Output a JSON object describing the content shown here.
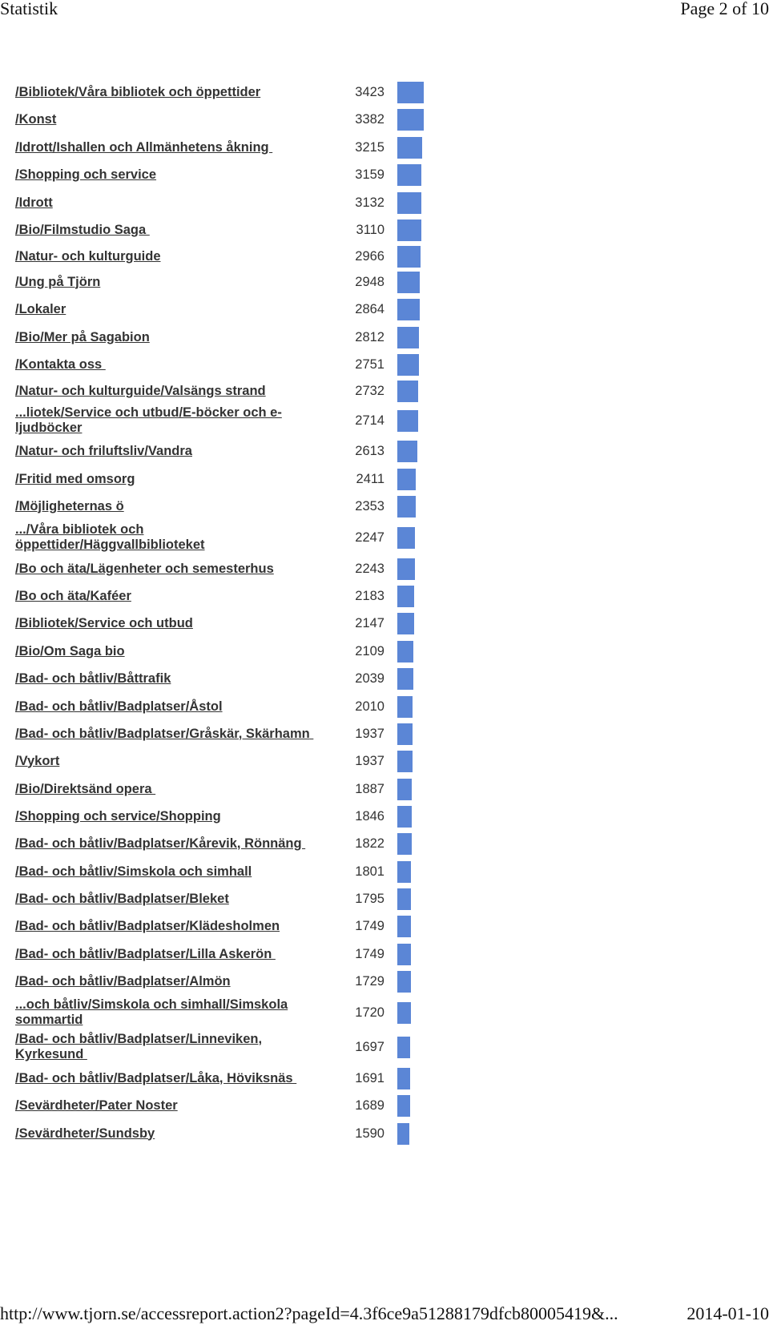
{
  "header": {
    "title": "Statistik",
    "page": "Page 2 of 10"
  },
  "footer": {
    "url": "http://www.tjorn.se/accessreport.action2?pageId=4.3f6ce9a51288179dfcb80005419&...",
    "date": "2014-01-10"
  },
  "colors": {
    "bar": "#5B86D6",
    "text": "#333333"
  },
  "chart_data": {
    "type": "bar",
    "orientation": "horizontal",
    "title": "",
    "xlabel": "",
    "ylabel": "",
    "xlim": [
      0,
      3423
    ],
    "grid": false,
    "categories": [
      "/Bibliotek/Våra bibliotek och öppettider",
      "/Konst",
      "/Idrott/Ishallen och Allmänhetens åkning ",
      "/Shopping och service",
      "/Idrott",
      "/Bio/Filmstudio Saga ",
      "/Natur- och kulturguide",
      "/Ung på Tjörn",
      "/Lokaler",
      "/Bio/Mer på Sagabion",
      "/Kontakta oss ",
      "/Natur- och kulturguide/Valsängs strand",
      "...liotek/Service och utbud/E-böcker och e-ljudböcker",
      "/Natur- och friluftsliv/Vandra",
      "/Fritid med omsorg",
      "/Möjligheternas ö",
      ".../Våra bibliotek och öppettider/Häggvallbiblioteket",
      "/Bo och äta/Lägenheter och semesterhus",
      "/Bo och äta/Kaféer",
      "/Bibliotek/Service och utbud",
      "/Bio/Om Saga bio",
      "/Bad- och båtliv/Båttrafik",
      "/Bad- och båtliv/Badplatser/Åstol",
      "/Bad- och båtliv/Badplatser/Gråskär, Skärhamn ",
      "/Vykort",
      "/Bio/Direktsänd opera ",
      "/Shopping och service/Shopping",
      "/Bad- och båtliv/Badplatser/Kårevik, Rönnäng ",
      "/Bad- och båtliv/Simskola och simhall",
      "/Bad- och båtliv/Badplatser/Bleket",
      "/Bad- och båtliv/Badplatser/Klädesholmen",
      "/Bad- och båtliv/Badplatser/Lilla Askerön ",
      "/Bad- och båtliv/Badplatser/Almön",
      "...och båtliv/Simskola och simhall/Simskola sommartid",
      "/Bad- och båtliv/Badplatser/Linneviken, Kyrkesund ",
      "/Bad- och båtliv/Badplatser/Låka, Höviksnäs ",
      "/Sevärdheter/Pater Noster",
      "/Sevärdheter/Sundsby"
    ],
    "values": [
      3423,
      3382,
      3215,
      3159,
      3132,
      3110,
      2966,
      2948,
      2864,
      2812,
      2751,
      2732,
      2714,
      2613,
      2411,
      2353,
      2247,
      2243,
      2183,
      2147,
      2109,
      2039,
      2010,
      1937,
      1937,
      1887,
      1846,
      1822,
      1801,
      1795,
      1749,
      1749,
      1729,
      1720,
      1697,
      1691,
      1689,
      1590
    ]
  }
}
